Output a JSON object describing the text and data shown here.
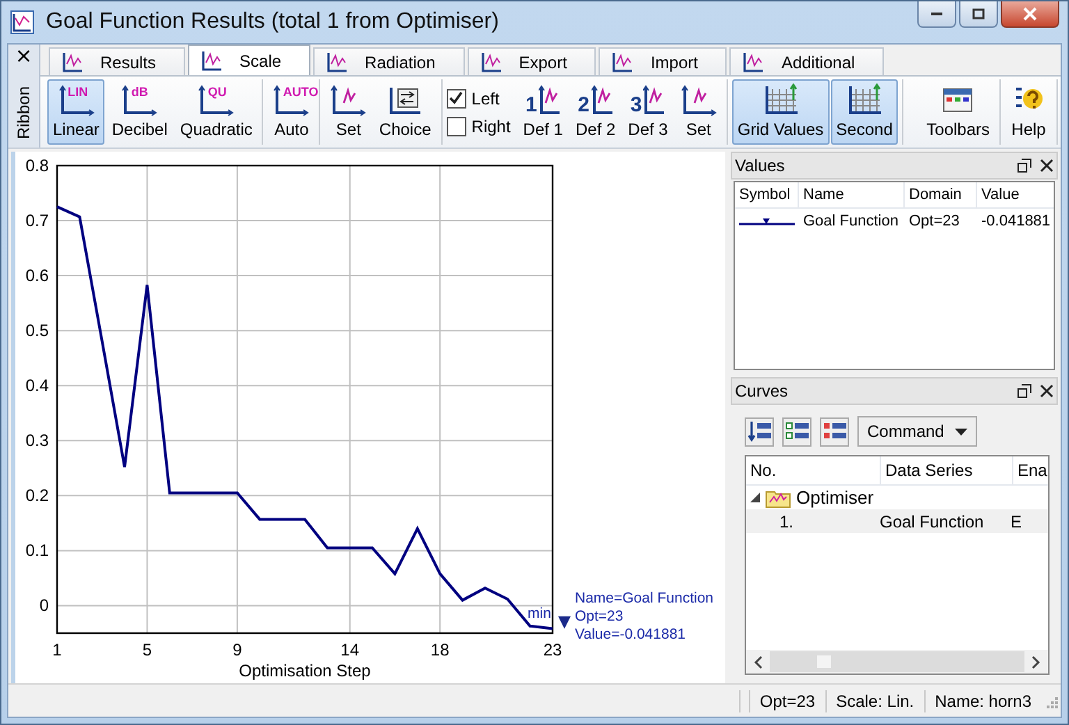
{
  "window": {
    "title": "Goal Function Results (total 1 from Optimiser)"
  },
  "ribbon": {
    "label": "Ribbon",
    "close": "×",
    "tabs": [
      {
        "label": "Results",
        "selected": false
      },
      {
        "label": "Scale",
        "selected": true
      },
      {
        "label": "Radiation",
        "selected": false
      },
      {
        "label": "Export",
        "selected": false
      },
      {
        "label": "Import",
        "selected": false
      },
      {
        "label": "Additional",
        "selected": false
      }
    ],
    "groups": [
      {
        "items": [
          {
            "kind": "scale",
            "label": "Linear",
            "icon_text": "LIN",
            "selected": true
          },
          {
            "kind": "scale",
            "label": "Decibel",
            "icon_text": "dB",
            "selected": false
          },
          {
            "kind": "scale",
            "label": "Quadratic",
            "icon_text": "QU",
            "selected": false
          }
        ]
      },
      {
        "items": [
          {
            "kind": "scale",
            "label": "Auto",
            "icon_text": "AUTO",
            "selected": false
          }
        ]
      },
      {
        "items": [
          {
            "kind": "scale",
            "label": "Set",
            "selected": false
          },
          {
            "kind": "choice",
            "label": "Choice",
            "selected": false
          }
        ]
      },
      {
        "items": [
          {
            "kind": "checks",
            "checks": [
              {
                "label": "Left",
                "checked": true
              },
              {
                "label": "Right",
                "checked": false
              }
            ]
          },
          {
            "kind": "scale",
            "label": "Def 1",
            "icon_text": "1",
            "selected": false
          },
          {
            "kind": "scale",
            "label": "Def 2",
            "icon_text": "2",
            "selected": false
          },
          {
            "kind": "scale",
            "label": "Def 3",
            "icon_text": "3",
            "selected": false
          },
          {
            "kind": "scale",
            "label": "Set",
            "selected": false
          }
        ]
      },
      {
        "items": [
          {
            "kind": "grid",
            "label": "Grid Values",
            "selected": true
          },
          {
            "kind": "grid",
            "label": "Second",
            "selected": true
          }
        ]
      }
    ],
    "right_groups": [
      {
        "items": [
          {
            "kind": "toolbars",
            "label": "Toolbars",
            "selected": false
          }
        ]
      },
      {
        "items": [
          {
            "kind": "help",
            "label": "Help",
            "selected": false
          }
        ]
      }
    ]
  },
  "chart": {
    "chart_data": {
      "type": "line",
      "xlabel": "Optimisation Step",
      "x": [
        1,
        2,
        3,
        4,
        5,
        6,
        7,
        8,
        9,
        10,
        11,
        12,
        13,
        14,
        15,
        16,
        17,
        18,
        19,
        20,
        21,
        22,
        23
      ],
      "series": [
        {
          "color": "#000080",
          "values": [
            0.725,
            0.707,
            0.48,
            0.252,
            0.583,
            0.205,
            0.205,
            0.205,
            0.205,
            0.157,
            0.157,
            0.157,
            0.105,
            0.105,
            0.105,
            0.058,
            0.14,
            0.058,
            0.01,
            0.032,
            0.012,
            -0.037,
            -0.042
          ]
        }
      ],
      "xlim": [
        1,
        23
      ],
      "ylim": [
        -0.05,
        0.8
      ],
      "grid": true,
      "xticks": [
        1,
        5,
        9,
        14,
        18,
        23
      ],
      "yticks": [
        0,
        0.1,
        0.2,
        0.3,
        0.4,
        0.5,
        0.6,
        0.7,
        0.8
      ],
      "annotations": [
        {
          "text": "min"
        },
        {
          "text": "Name=Goal Function"
        },
        {
          "text": "Opt=23"
        },
        {
          "text": "Value=-0.041881"
        }
      ]
    }
  },
  "values_panel": {
    "title": "Values",
    "columns": [
      "Symbol",
      "Name",
      "Domain",
      "Value"
    ],
    "rows": [
      {
        "name": "Goal Function",
        "domain": "Opt=23",
        "value": "-0.041881"
      }
    ]
  },
  "curves_panel": {
    "title": "Curves",
    "command": "Command",
    "columns": [
      "No.",
      "Data Series",
      "Ena"
    ],
    "tree": [
      {
        "label": "Optimiser",
        "expanded": true,
        "children": [
          {
            "no": "1.",
            "series": "Goal Function",
            "column_3": "E",
            "selected": true
          }
        ]
      }
    ]
  },
  "status_bar": {
    "cells": [
      "Opt=23",
      "Scale: Lin.",
      "Name: horn3"
    ]
  }
}
